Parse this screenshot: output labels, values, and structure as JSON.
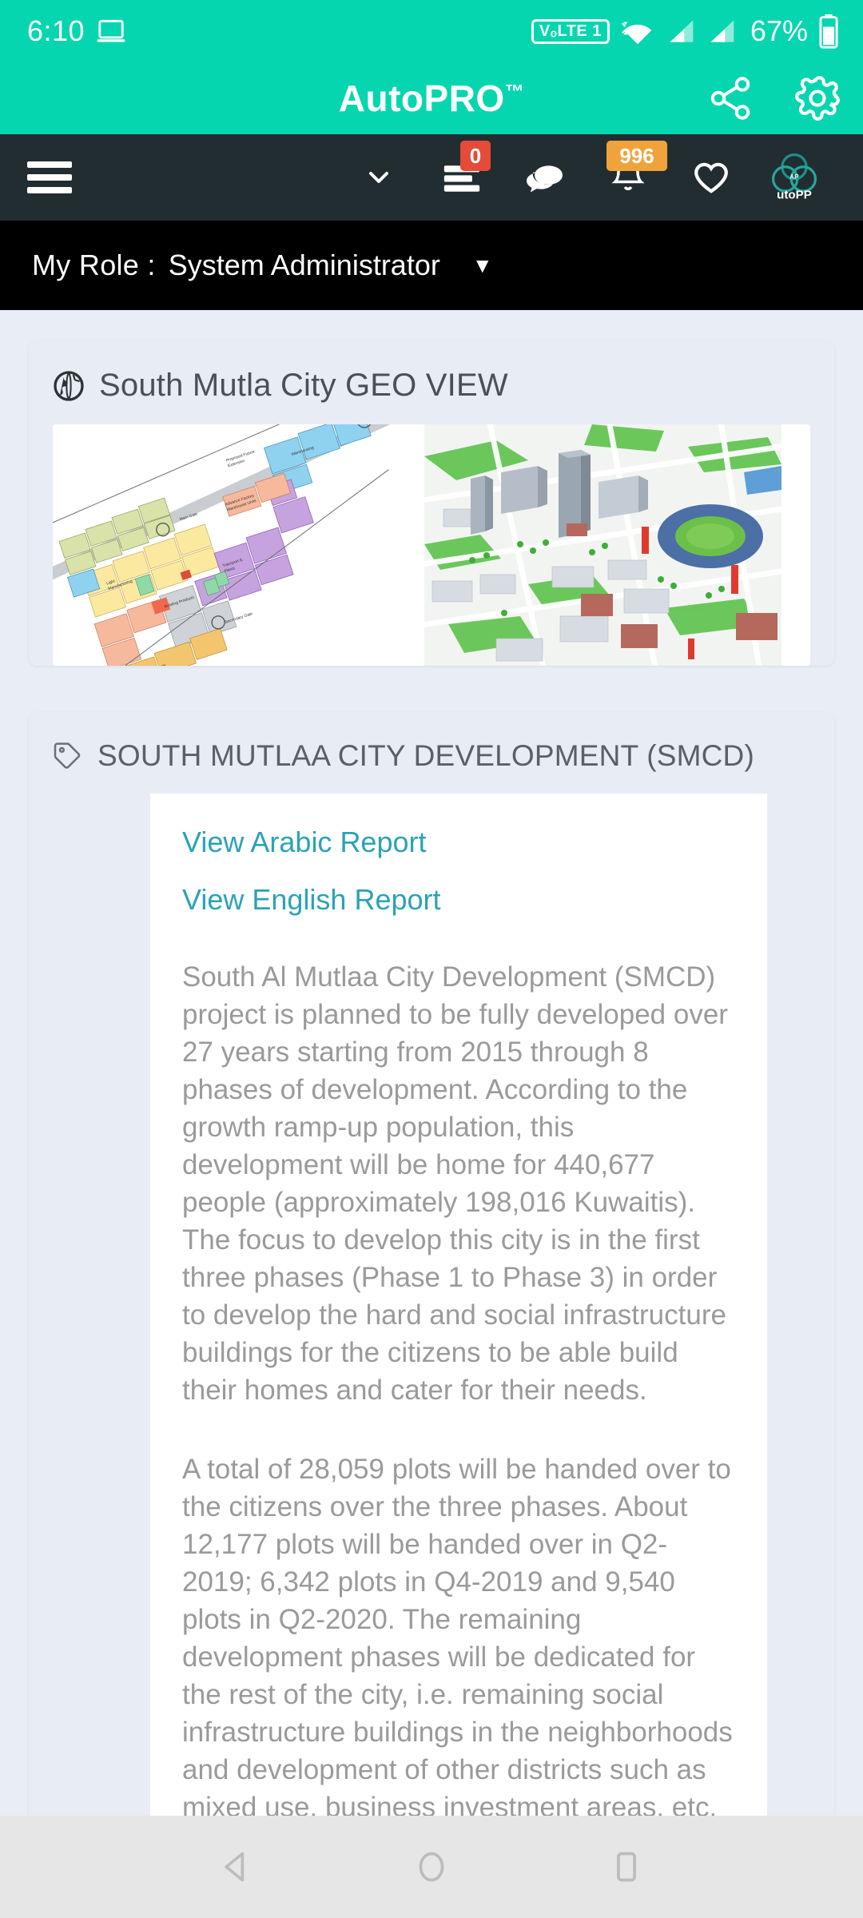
{
  "status_bar": {
    "time": "6:10",
    "cast_icon": "laptop-icon",
    "volte_label": "VₒLTE 1",
    "wifi_icon": "wifi-icon",
    "signal_icon_1": "signal-bars-icon",
    "signal_icon_2": "signal-bars-icon",
    "battery_percent": "67%",
    "battery_icon": "battery-icon"
  },
  "app_bar": {
    "title": "AutoPRO",
    "trademark": "™",
    "share_icon": "share-icon",
    "settings_icon": "gear-icon",
    "background_color": "#06D6B0"
  },
  "nav_bar": {
    "background_color": "#222d32",
    "menu_icon": "hamburger-menu-icon",
    "chevron_icon": "chevron-down-icon",
    "items": [
      {
        "icon": "tasks-list-icon",
        "badge": "0",
        "badge_color": "#e44b39"
      },
      {
        "icon": "chat-bubbles-icon",
        "badge": "",
        "badge_color": ""
      },
      {
        "icon": "bell-icon",
        "badge": "996",
        "badge_color": "#f1a33b"
      },
      {
        "icon": "heart-icon",
        "badge": "",
        "badge_color": ""
      },
      {
        "icon": "autopp-logo-icon",
        "badge": "",
        "badge_color": "",
        "logo_text": "utoPP"
      }
    ]
  },
  "role_bar": {
    "label": "My Role :",
    "value": "System Administrator",
    "caret": "▼",
    "background_color": "#000000"
  },
  "geo_card": {
    "icon": "globe-icon",
    "title": "South Mutla City GEO VIEW",
    "left_image_alt": "land-use-zoning-map",
    "right_image_alt": "3d-city-aerial-render"
  },
  "smcd_card": {
    "icon": "tag-icon",
    "title": "SOUTH MUTLAA CITY DEVELOPMENT (SMCD)",
    "links": [
      {
        "label": "View Arabic Report",
        "color": "#2aa3b5"
      },
      {
        "label": "View English Report",
        "color": "#2aa3b5"
      }
    ],
    "paragraphs": [
      "South Al Mutlaa City Development (SMCD) project is planned to be fully developed over 27 years starting from 2015 through 8 phases of development. According to the growth ramp-up population, this development will be home for 440,677 people (approximately 198,016 Kuwaitis). The focus to develop this city is in the first three phases (Phase 1 to Phase 3) in order to develop the hard and social infrastructure buildings for the citizens to be able build their homes and cater for their needs.",
      "A total of 28,059 plots will be handed over to the citizens over the three phases. About 12,177 plots will be handed over in Q2-2019; 6,342 plots in Q4-2019 and 9,540 plots in Q2-2020. The remaining development phases will be dedicated for the rest of the city, i.e. remaining social infrastructure buildings in the neighborhoods and development of other districts such as mixed use, business investment areas, etc."
    ]
  },
  "android_nav": {
    "back_icon": "back-triangle-icon",
    "home_icon": "home-circle-icon",
    "recents_icon": "recents-square-icon"
  }
}
